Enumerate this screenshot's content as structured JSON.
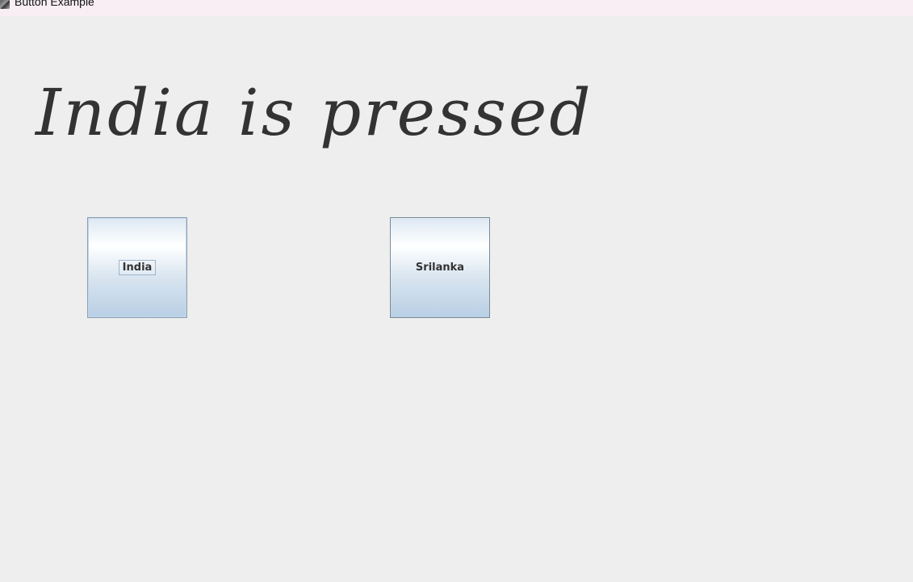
{
  "window": {
    "title": "Button Example"
  },
  "main": {
    "status_text": "India is pressed",
    "buttons": [
      {
        "label": "India",
        "focused": true
      },
      {
        "label": "Srilanka",
        "focused": false
      }
    ]
  },
  "colors": {
    "background": "#eeeeee",
    "titlebar": "#f8eef4",
    "text": "#333333",
    "button_border": "#7a8a99",
    "button_gradient_top": "#ffffff",
    "button_gradient_bottom": "#b8cfe5"
  },
  "icons": {
    "app": "java-app-icon"
  }
}
